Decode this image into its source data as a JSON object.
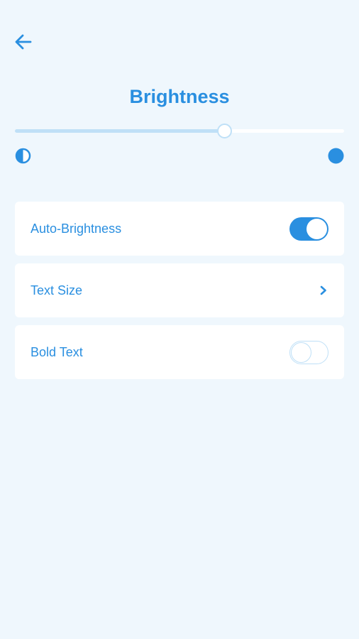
{
  "header": {
    "back_icon": "arrow-left-icon",
    "title": "Brightness"
  },
  "brightness": {
    "level": 0.635,
    "min_icon": "contrast-half-circle-icon",
    "max_icon": "full-circle-icon"
  },
  "settings": [
    {
      "label": "Auto-Brightness",
      "control": "toggle",
      "value": true
    },
    {
      "label": "Text Size",
      "control": "chevron-right-icon"
    },
    {
      "label": "Bold Text",
      "control": "toggle",
      "value": false
    }
  ],
  "colors": {
    "background": "#eff7fd",
    "accent": "#2a8fe0",
    "track_light": "#bfe0f7",
    "card": "#ffffff"
  }
}
